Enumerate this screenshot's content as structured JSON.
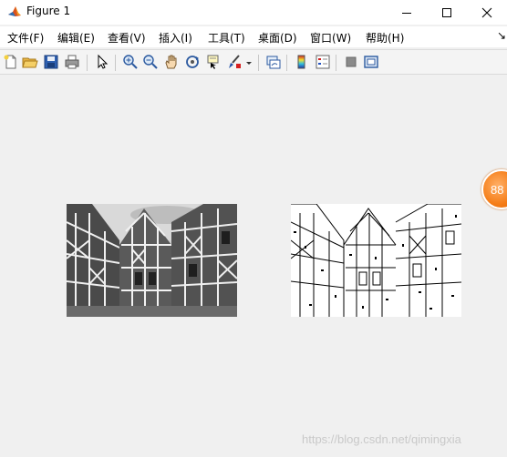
{
  "window": {
    "title": "Figure 1",
    "controls": {
      "minimize": "minimize",
      "maximize": "maximize",
      "close": "close"
    }
  },
  "menu": {
    "items": [
      {
        "label": "文件(F)"
      },
      {
        "label": "编辑(E)"
      },
      {
        "label": "查看(V)"
      },
      {
        "label": "插入(I)"
      },
      {
        "label": "工具(T)"
      },
      {
        "label": "桌面(D)"
      },
      {
        "label": "窗口(W)"
      },
      {
        "label": "帮助(H)"
      }
    ],
    "dock_arrow": "↘"
  },
  "toolbar": {
    "buttons": [
      {
        "icon": "new-figure-icon"
      },
      {
        "icon": "open-file-icon"
      },
      {
        "icon": "save-icon"
      },
      {
        "icon": "print-icon"
      },
      {
        "icon": "edit-plot-icon"
      },
      {
        "icon": "zoom-in-icon"
      },
      {
        "icon": "zoom-out-icon"
      },
      {
        "icon": "pan-icon"
      },
      {
        "icon": "rotate-3d-icon"
      },
      {
        "icon": "data-cursor-icon"
      },
      {
        "icon": "brush-icon"
      },
      {
        "icon": "link-plot-icon"
      },
      {
        "icon": "colorbar-icon"
      },
      {
        "icon": "legend-icon"
      },
      {
        "icon": "hide-plot-tools-icon"
      },
      {
        "icon": "show-plot-tools-icon"
      }
    ]
  },
  "figure": {
    "panels": [
      {
        "name": "grayscale-image",
        "content": "half-timbered houses, grayscale"
      },
      {
        "name": "edge-image",
        "content": "half-timbered houses, binary edge map"
      }
    ]
  },
  "overlay": {
    "badge_text": "88"
  },
  "watermark": {
    "text": "https://blog.csdn.net/qimingxia"
  }
}
